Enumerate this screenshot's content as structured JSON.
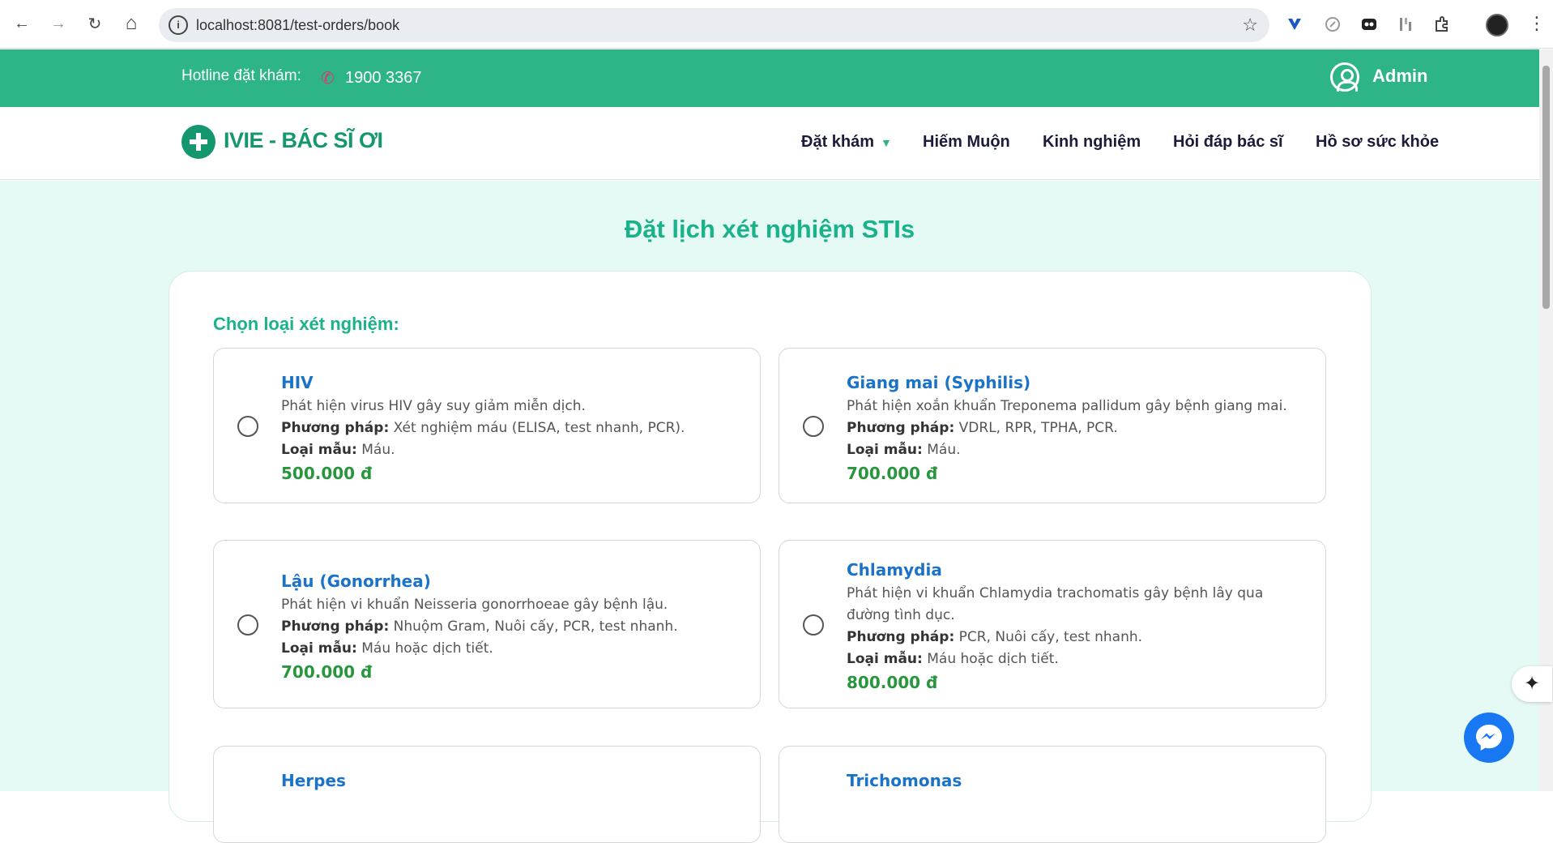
{
  "browser": {
    "url": "localhost:8081/test-orders/book",
    "back_icon": "←",
    "forward_icon": "→",
    "reload_icon": "↻",
    "home_icon": "⌂",
    "info_icon": "i",
    "star_icon": "☆"
  },
  "topbar": {
    "hotline_label": "Hotline đặt khám:",
    "phone_icon": "✆",
    "hotline_number": "1900 3367",
    "user_name": "Admin"
  },
  "header": {
    "logo_text": "IVIE - BÁC SĨ ƠI",
    "nav": {
      "book": "Đặt khám",
      "caret": "▼",
      "infertility": "Hiếm Muộn",
      "experience": "Kinh nghiệm",
      "ask_doctor": "Hỏi đáp bác sĩ",
      "health_profile": "Hồ sơ sức khỏe"
    }
  },
  "main": {
    "title": "Đặt lịch xét nghiệm STIs",
    "section_label": "Chọn loại xét nghiệm:",
    "method_label": "Phương pháp:",
    "sample_label": "Loại mẫu:",
    "tests": [
      {
        "name": "HIV",
        "description": "Phát hiện virus HIV gây suy giảm miễn dịch.",
        "method": "Xét nghiệm máu (ELISA, test nhanh, PCR).",
        "sample": "Máu.",
        "price": "500.000 đ"
      },
      {
        "name": "Giang mai (Syphilis)",
        "description": "Phát hiện xoắn khuẩn Treponema pallidum gây bệnh giang mai.",
        "method": "VDRL, RPR, TPHA, PCR.",
        "sample": "Máu.",
        "price": "700.000 đ"
      },
      {
        "name": "Lậu (Gonorrhea)",
        "description": "Phát hiện vi khuẩn Neisseria gonorrhoeae gây bệnh lậu.",
        "method": "Nhuộm Gram, Nuôi cấy, PCR, test nhanh.",
        "sample": "Máu hoặc dịch tiết.",
        "price": "700.000 đ"
      },
      {
        "name": "Chlamydia",
        "description": "Phát hiện vi khuẩn Chlamydia trachomatis gây bệnh lây qua đường tình dục.",
        "method": "PCR, Nuôi cấy, test nhanh.",
        "sample": "Máu hoặc dịch tiết.",
        "price": "800.000 đ"
      },
      {
        "name": "Herpes"
      },
      {
        "name": "Trichomonas"
      }
    ]
  },
  "widgets": {
    "sparkle_icon": "✦"
  }
}
